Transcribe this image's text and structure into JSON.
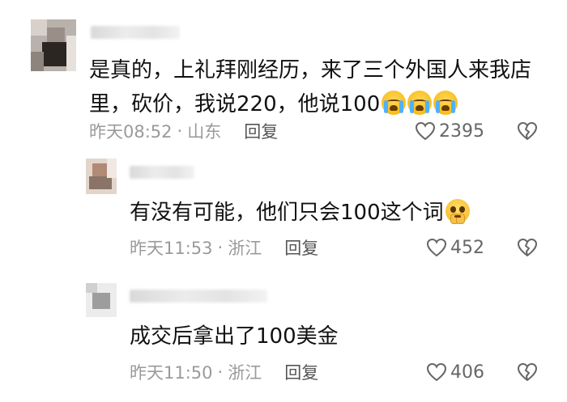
{
  "comments": [
    {
      "text": "是真的，上礼拜刚经历，来了三个外国人来我店里，砍价，我说220，他说100",
      "line1": "是真的，上礼拜刚经历，来了三个外国人来我店",
      "line2": "里，砍价，我说220，他说100",
      "emoji": [
        "loudly-crying-face",
        "loudly-crying-face",
        "loudly-crying-face"
      ],
      "time": "昨天08:52",
      "location": "山东",
      "reply_label": "回复",
      "likes": "2395"
    },
    {
      "text": "有没有可能，他们只会100这个词",
      "emoji": [
        "pleading-face-with-hands"
      ],
      "time": "昨天11:53",
      "location": "浙江",
      "reply_label": "回复",
      "likes": "452"
    },
    {
      "text": "成交后拿出了100美金",
      "time": "昨天11:50",
      "location": "浙江",
      "reply_label": "回复",
      "likes": "406"
    }
  ],
  "icons": {
    "like": "heart-outline-icon",
    "dislike": "broken-heart-icon"
  },
  "colors": {
    "text": "#111111",
    "meta": "#9a9a9a",
    "icon": "#666666"
  }
}
